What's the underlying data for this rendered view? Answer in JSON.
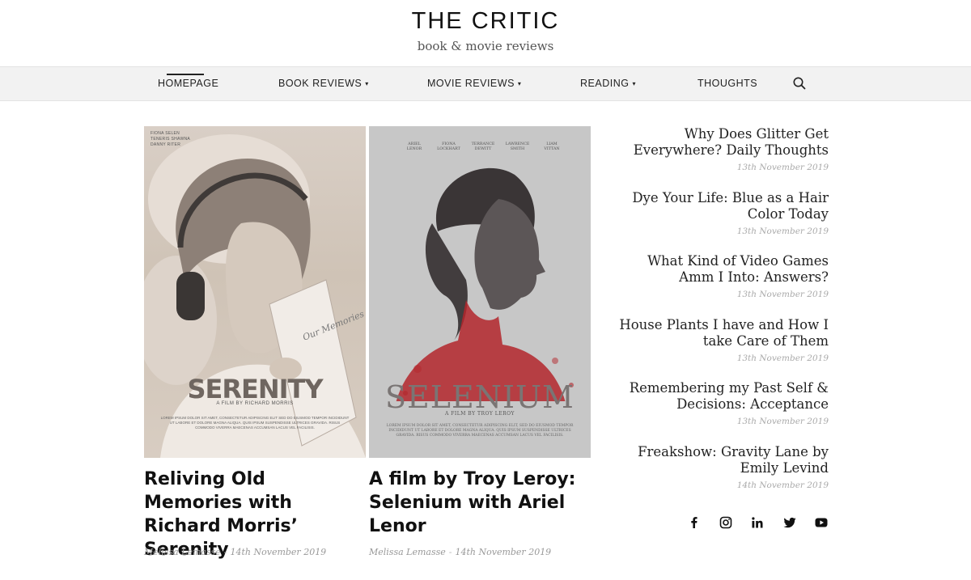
{
  "header": {
    "title": "THE CRITIC",
    "tagline": "book & movie reviews"
  },
  "nav": {
    "items": [
      {
        "label": "HOMEPAGE",
        "has_dropdown": false,
        "active": true
      },
      {
        "label": "BOOK REVIEWS",
        "has_dropdown": true,
        "active": false
      },
      {
        "label": "MOVIE REVIEWS",
        "has_dropdown": true,
        "active": false
      },
      {
        "label": "READING",
        "has_dropdown": true,
        "active": false
      },
      {
        "label": "THOUGHTS",
        "has_dropdown": false,
        "active": false
      }
    ],
    "caret": "▾",
    "search_icon": "search-icon"
  },
  "posters": {
    "serenity": {
      "credits": [
        "FIONA SELEN",
        "TENERIS SHAWNA",
        "DANNY RITER"
      ],
      "book_text": "Our Memories",
      "title": "SERENITY",
      "subtitle": "A FILM BY RICHARD MORRIS",
      "body": "LOREM IPSUM DOLOR SIT AMET, CONSECTETUR ADIPISCING ELIT SED DO EIUSMOD TEMPOR INCIDIDUNT UT LABORE ET DOLORE MAGNA ALIQUA. QUIS IPSUM SUSPENDISSE ULTRICES GRAVIDA. RISUS COMMODO VIVERRA MAECENAS ACCUMSAN LACUS VEL FACILISIS."
    },
    "selenium": {
      "cast": [
        {
          "first": "ARIEL",
          "last": "LENOR"
        },
        {
          "first": "FIONA",
          "last": "LOCKHART"
        },
        {
          "first": "TERRANCE",
          "last": "DEWITT"
        },
        {
          "first": "LAWRENCE",
          "last": "SMITH"
        },
        {
          "first": "LIAM",
          "last": "VITTAN"
        }
      ],
      "title": "SELENIUM",
      "subtitle": "A FILM BY TROY LEROY",
      "body": "LOREM IPSUM DOLOR SIT AMET, CONSECTETUR ADIPISCING ELIT, SED DO EIUSMOD TEMPOR INCIDIDUNT UT LABORE ET DOLORE MAGNA ALIQUA. QUIS IPSUM SUSPENDISSE ULTRICES GRAVIDA. RISUS COMMODO VIVERRA MAECENAS ACCUMSAN LACUS VEL FACILISIS."
    }
  },
  "articles": [
    {
      "title": "Reliving Old Memories with Richard Morris’ Serenity",
      "author": "Melissa Lemasse",
      "date": "14th November 2019"
    },
    {
      "title": "A film by Troy Leroy: Selenium with Ariel Lenor",
      "author": "Melissa Lemasse",
      "date": "14th November 2019"
    }
  ],
  "sidebar": {
    "posts": [
      {
        "title": "Why Does Glitter Get Everywhere? Daily Thoughts",
        "date": "13th November 2019"
      },
      {
        "title": "Dye Your Life: Blue as a Hair Color Today",
        "date": "13th November 2019"
      },
      {
        "title": "What Kind of Video Games Amm I Into: Answers?",
        "date": "13th November 2019"
      },
      {
        "title": "House Plants I have and How I take Care of Them",
        "date": "13th November 2019"
      },
      {
        "title": "Remembering my Past Self & Decisions: Acceptance",
        "date": "13th November 2019"
      },
      {
        "title": "Freakshow: Gravity Lane by Emily Levind",
        "date": "14th November 2019"
      }
    ]
  },
  "social": [
    "facebook-icon",
    "instagram-icon",
    "linkedin-icon",
    "twitter-icon",
    "youtube-icon"
  ],
  "colors": {
    "nav_bg": "#f2f2f2",
    "selenium_red": "#b3262b",
    "meta_gray": "#999999"
  }
}
